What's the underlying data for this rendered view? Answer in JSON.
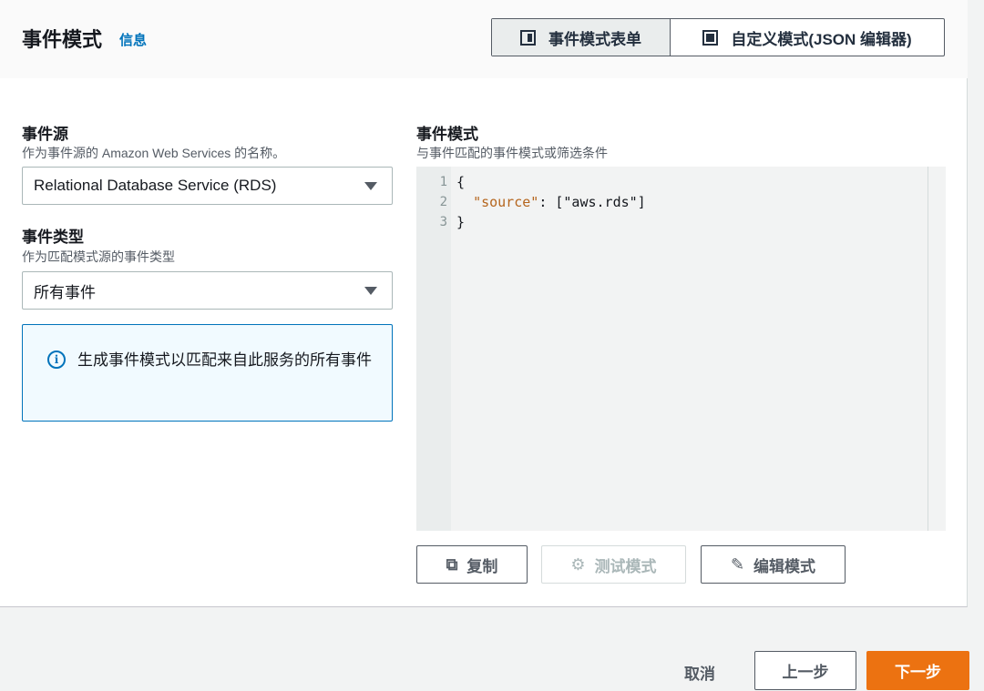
{
  "header": {
    "title": "事件模式",
    "info_link": "信息",
    "tabs": [
      {
        "label": "事件模式表单",
        "icon": "half-panel-icon",
        "active": true
      },
      {
        "label": "自定义模式(JSON 编辑器)",
        "icon": "full-panel-icon",
        "active": false
      }
    ]
  },
  "event_source": {
    "label": "事件源",
    "description": "作为事件源的 Amazon Web Services 的名称。",
    "selected": "Relational Database Service (RDS)"
  },
  "event_type": {
    "label": "事件类型",
    "description": "作为匹配模式源的事件类型",
    "selected": "所有事件"
  },
  "alert": {
    "icon": "info-icon",
    "text": "生成事件模式以匹配来自此服务的所有事件"
  },
  "pattern": {
    "label": "事件模式",
    "description": "与事件匹配的事件模式或筛选条件",
    "lines": [
      {
        "num": "1",
        "open": "{"
      },
      {
        "num": "2",
        "key": "\"source\"",
        "rest": ": [\"aws.rds\"]"
      },
      {
        "num": "3",
        "close": "}"
      }
    ]
  },
  "actions": {
    "copy": "复制",
    "test": "测试模式",
    "edit": "编辑模式"
  },
  "footer": {
    "cancel": "取消",
    "prev": "上一步",
    "next": "下一步"
  },
  "colors": {
    "primary": "#ec7211",
    "link": "#0073bb",
    "alert_bg": "#f1faff"
  }
}
